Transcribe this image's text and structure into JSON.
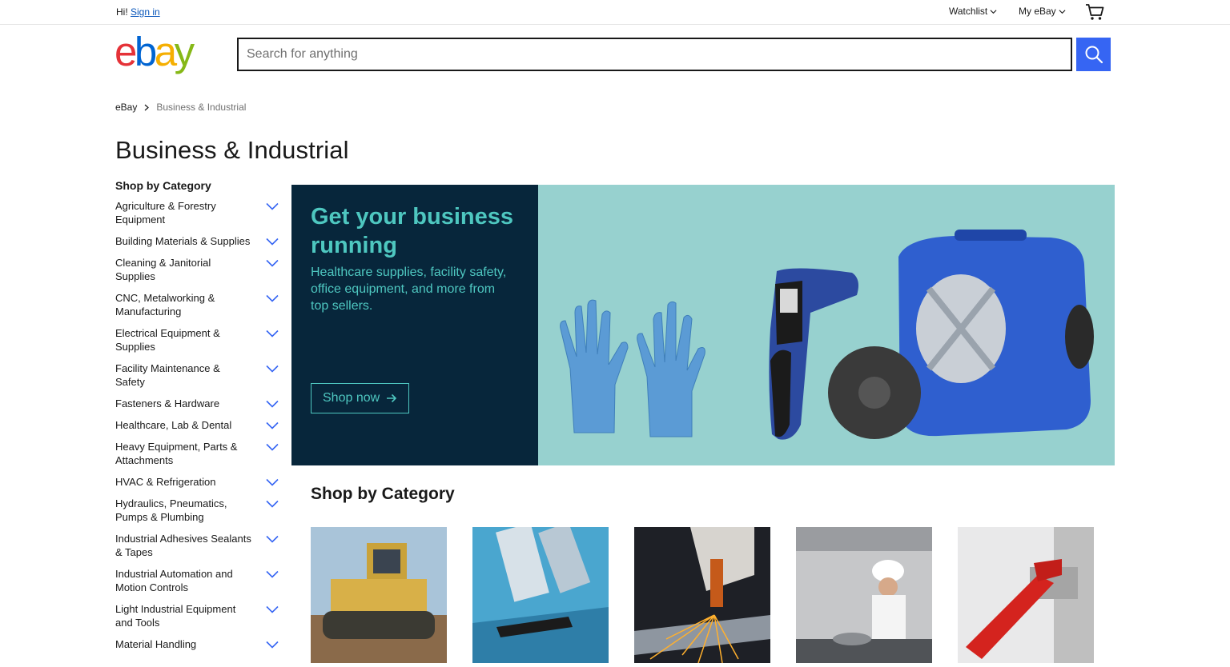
{
  "topbar": {
    "greeting": "Hi!",
    "signin": "Sign in",
    "watchlist": "Watchlist",
    "myebay": "My eBay"
  },
  "search": {
    "placeholder": "Search for anything"
  },
  "breadcrumb": {
    "home": "eBay",
    "current": "Business & Industrial"
  },
  "page_title": "Business & Industrial",
  "sidebar": {
    "heading": "Shop by Category",
    "items": [
      {
        "label": "Agriculture & Forestry Equipment"
      },
      {
        "label": "Building Materials & Supplies"
      },
      {
        "label": "Cleaning & Janitorial Supplies"
      },
      {
        "label": "CNC, Metalworking & Manufacturing"
      },
      {
        "label": "Electrical Equipment & Supplies"
      },
      {
        "label": "Facility Maintenance & Safety"
      },
      {
        "label": "Fasteners & Hardware"
      },
      {
        "label": "Healthcare, Lab & Dental"
      },
      {
        "label": "Heavy Equipment, Parts & Attachments"
      },
      {
        "label": "HVAC & Refrigeration"
      },
      {
        "label": "Hydraulics, Pneumatics, Pumps & Plumbing"
      },
      {
        "label": "Industrial Adhesives Sealants & Tapes"
      },
      {
        "label": "Industrial Automation and Motion Controls"
      },
      {
        "label": "Light Industrial Equipment and Tools"
      },
      {
        "label": "Material Handling"
      }
    ]
  },
  "hero": {
    "title": "Get your business running",
    "subtitle": "Healthcare supplies, facility safety, office equipment, and more from top sellers.",
    "cta": "Shop now"
  },
  "category_section": {
    "title": "Shop by Category"
  },
  "colors": {
    "accent": "#3665f3",
    "link": "#0654ba",
    "hero_dark": "#07263b",
    "hero_light": "#97d1cf",
    "hero_text": "#4ec7c0"
  }
}
